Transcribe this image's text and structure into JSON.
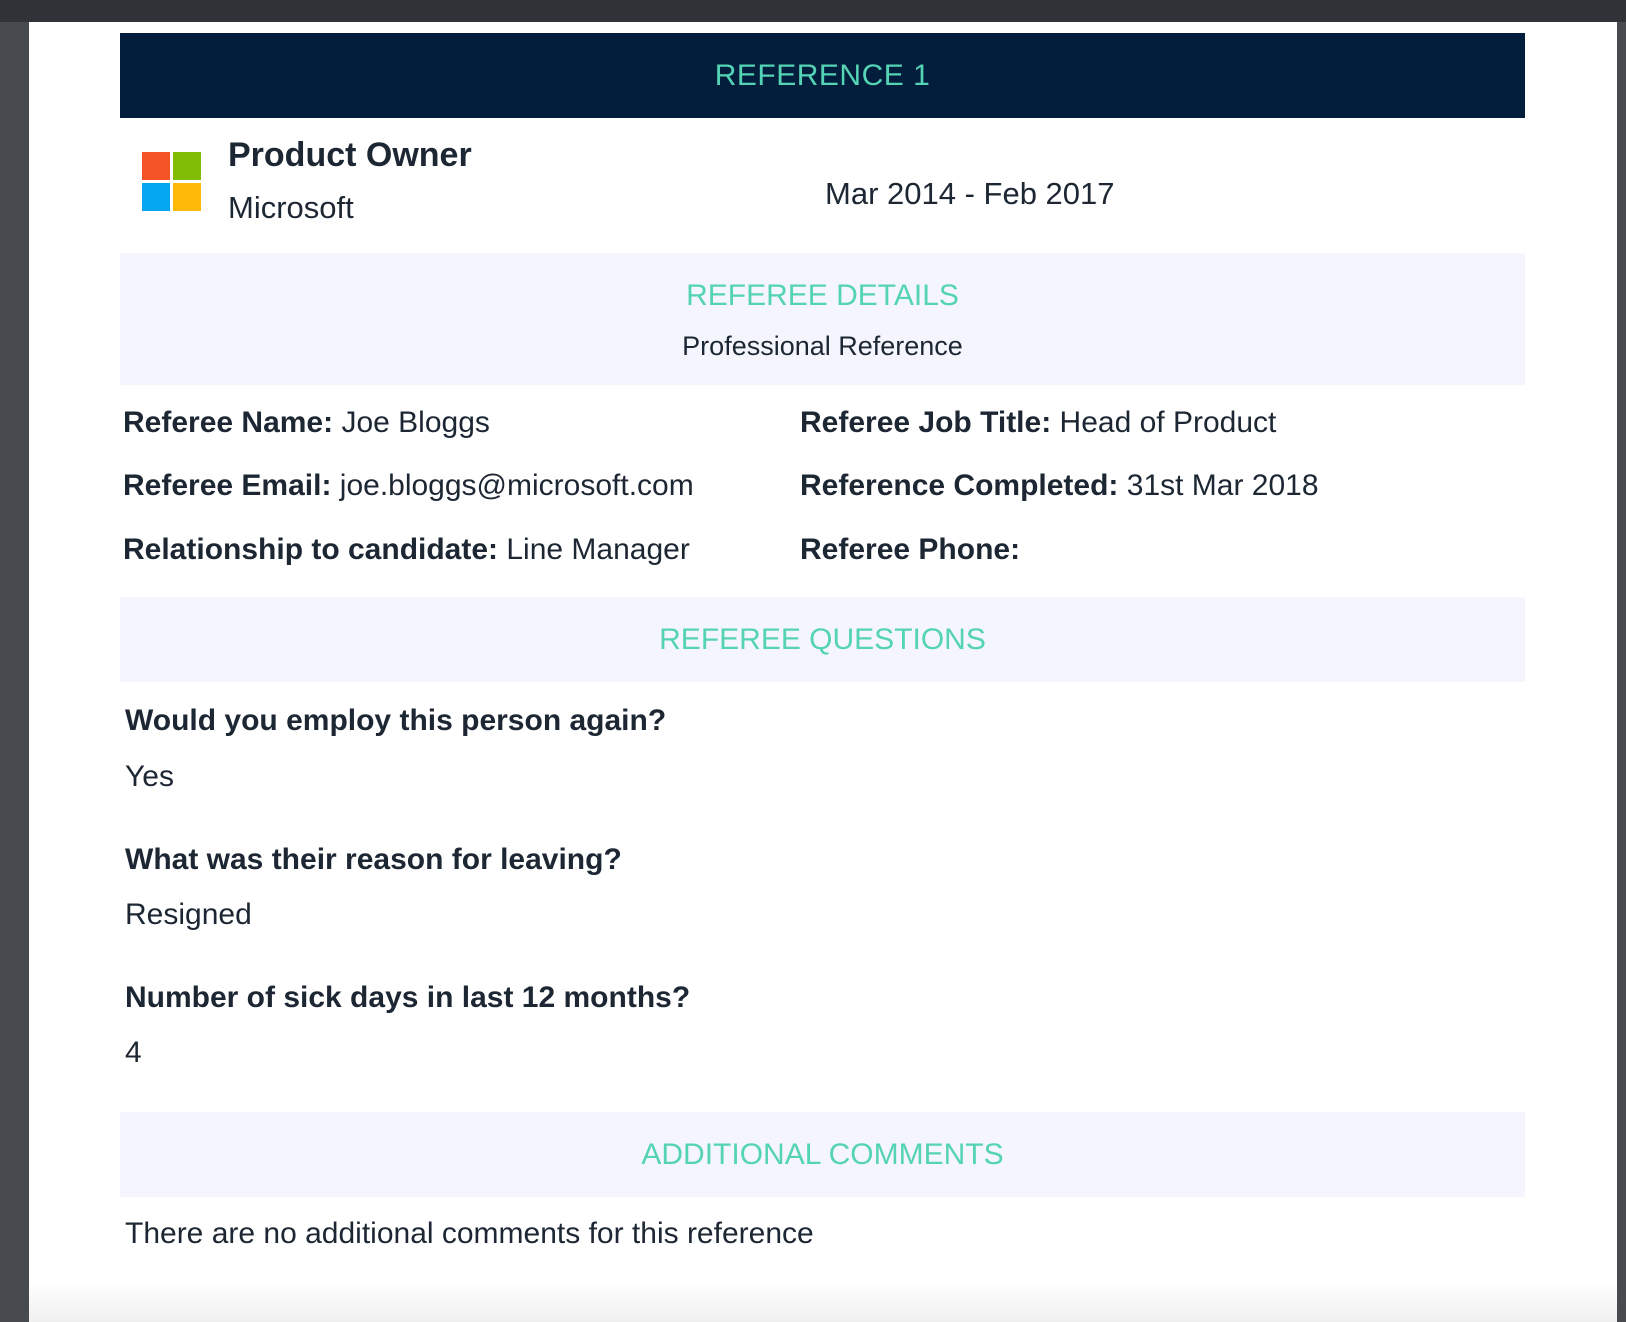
{
  "reference": {
    "header": "REFERENCE 1",
    "job_title": "Product Owner",
    "company": "Microsoft",
    "dates": "Mar 2014 - Feb 2017",
    "logo_colors": [
      "#f35325",
      "#81bc06",
      "#05a6f0",
      "#ffba08"
    ]
  },
  "referee_details": {
    "title": "REFEREE DETAILS",
    "subtitle": "Professional Reference",
    "fields": [
      {
        "label": "Referee Name:",
        "value": "Joe Bloggs"
      },
      {
        "label": "Referee Job Title:",
        "value": "Head of Product"
      },
      {
        "label": "Referee Email:",
        "value": "joe.bloggs@microsoft.com"
      },
      {
        "label": "Reference Completed:",
        "value": "31st Mar 2018"
      },
      {
        "label": "Relationship to candidate:",
        "value": "Line Manager"
      },
      {
        "label": "Referee Phone:",
        "value": ""
      }
    ]
  },
  "referee_questions": {
    "title": "REFEREE QUESTIONS",
    "items": [
      {
        "question": "Would you employ this person again?",
        "answer": "Yes"
      },
      {
        "question": "What was their reason for leaving?",
        "answer": "Resigned"
      },
      {
        "question": "Number of sick days in last 12 months?",
        "answer": "4"
      }
    ]
  },
  "additional_comments": {
    "title": "ADDITIONAL COMMENTS",
    "text": "There are no additional comments for this reference"
  },
  "colors": {
    "header_bg": "#031e3c",
    "accent": "#54d3b5",
    "band_bg": "#f4f5fd",
    "text": "#1d2733"
  }
}
